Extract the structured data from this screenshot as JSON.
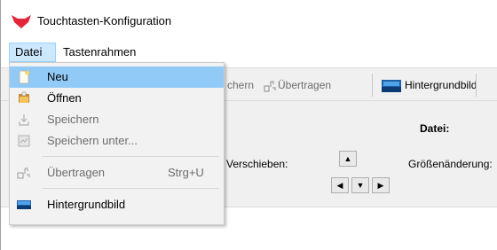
{
  "window": {
    "title": "Touchtasten-Konfiguration",
    "logo_icon": "fox-head-icon",
    "logo_color": "#e3263a"
  },
  "menubar": {
    "items": [
      {
        "label": "Datei",
        "active": true
      },
      {
        "label": "Tastenrahmen",
        "active": false
      }
    ]
  },
  "toolbar": {
    "speichern_partial": "chern",
    "uebertragen_label": "Übertragen",
    "hintergrund_label": "Hintergrundbild"
  },
  "panel": {
    "datei_label": "Datei:",
    "verschieben_partial": "Verschieben:",
    "groesse_label": "Größenänderung:",
    "arrows": {
      "up": "▲",
      "left": "◀",
      "down": "▼",
      "right": "▶"
    }
  },
  "dropdown": {
    "items": [
      {
        "label": "Neu",
        "icon": "new-file-icon",
        "enabled": true,
        "highlighted": true,
        "shortcut": ""
      },
      {
        "label": "Öffnen",
        "icon": "open-folder-icon",
        "enabled": true,
        "highlighted": false,
        "shortcut": ""
      },
      {
        "label": "Speichern",
        "icon": "save-icon",
        "enabled": false,
        "highlighted": false,
        "shortcut": ""
      },
      {
        "label": "Speichern unter...",
        "icon": "save-as-icon",
        "enabled": false,
        "highlighted": false,
        "shortcut": ""
      },
      {
        "label": "Übertragen",
        "icon": "transfer-icon",
        "enabled": false,
        "highlighted": false,
        "shortcut": "Strg+U"
      },
      {
        "label": "Hintergrundbild",
        "icon": "background-image-icon",
        "enabled": true,
        "highlighted": false,
        "shortcut": ""
      }
    ]
  },
  "colors": {
    "menu_active_bg": "#cce8ff",
    "menu_highlight_bg": "#91c9f7",
    "disabled_text": "#6d6d6d",
    "panel_bg": "#f0f0f0"
  }
}
